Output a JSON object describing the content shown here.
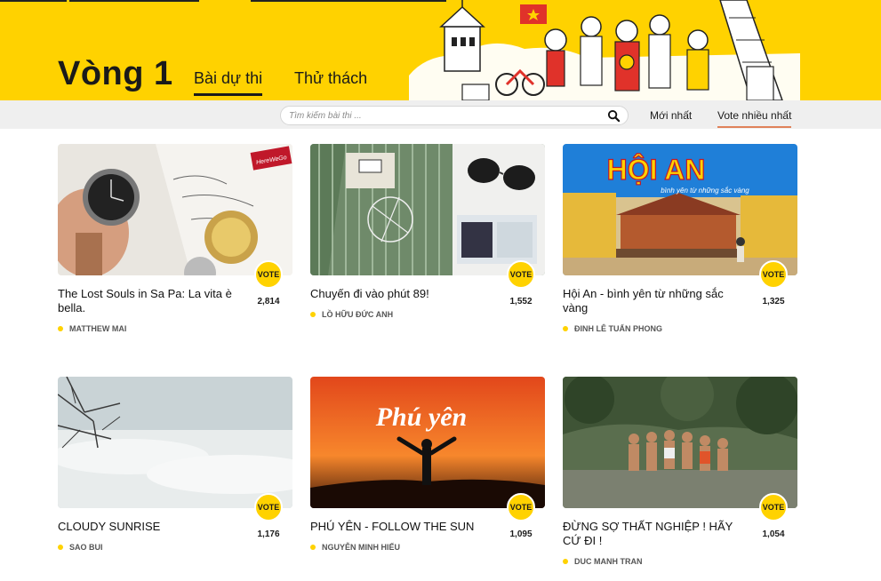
{
  "header": {
    "round_title": "Vòng 1",
    "tabs": [
      {
        "label": "Bài dự thi",
        "active": true
      },
      {
        "label": "Thử thách",
        "active": false
      }
    ],
    "brand_color": "#FFD200"
  },
  "toolbar": {
    "search_placeholder": "Tìm kiếm bài thi ...",
    "sort_options": [
      {
        "label": "Mới nhất",
        "active": false
      },
      {
        "label": "Vote nhiều nhất",
        "active": true
      }
    ]
  },
  "entries": [
    {
      "title": "The Lost Souls in Sa Pa: La vita è bella.",
      "author": "MATTHEW MAI",
      "vote_label": "VOTE",
      "votes": "2,814",
      "thumb_badge": "HereWeGo"
    },
    {
      "title": "Chuyến đi vào phút 89!",
      "author": "LỒ HỮU ĐỨC ANH",
      "vote_label": "VOTE",
      "votes": "1,552"
    },
    {
      "title": "Hội An - bình yên từ những sắc vàng",
      "author": "ĐINH LÊ TUẤN PHONG",
      "vote_label": "VOTE",
      "votes": "1,325",
      "thumb_text": "HỘI AN",
      "thumb_subtext": "bình yên từ những sắc vàng"
    },
    {
      "title": "CLOUDY SUNRISE",
      "author": "SAO BUI",
      "vote_label": "VOTE",
      "votes": "1,176"
    },
    {
      "title": "PHÚ YÊN - FOLLOW THE SUN",
      "author": "NGUYỄN MINH HIẾU",
      "vote_label": "VOTE",
      "votes": "1,095",
      "thumb_text": "Phú yên"
    },
    {
      "title": "ĐỪNG SỢ THẤT NGHIỆP ! HÃY CỨ ĐI !",
      "author": "DUC MANH TRAN",
      "vote_label": "VOTE",
      "votes": "1,054"
    }
  ]
}
